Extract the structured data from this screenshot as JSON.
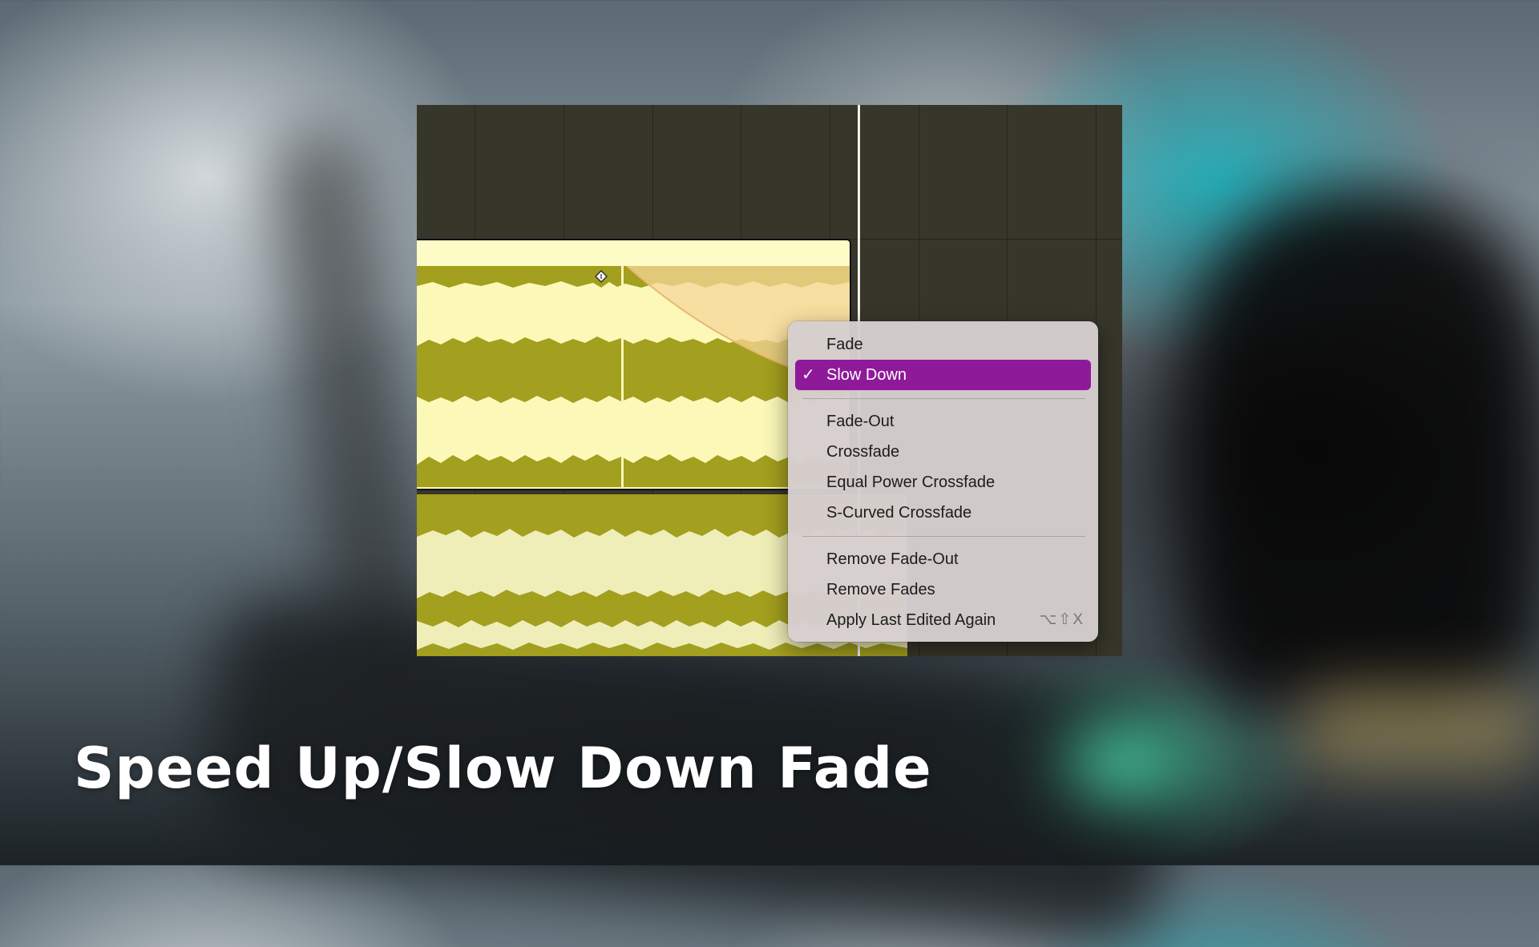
{
  "context_menu": {
    "items": [
      {
        "label": "Fade",
        "checked": false
      },
      {
        "label": "Slow Down",
        "checked": true,
        "check_glyph": "✓"
      },
      {
        "label": "Fade-Out"
      },
      {
        "label": "Crossfade"
      },
      {
        "label": "Equal Power Crossfade"
      },
      {
        "label": "S-Curved Crossfade"
      },
      {
        "label": "Remove Fade-Out"
      },
      {
        "label": "Remove Fades"
      },
      {
        "label": "Apply Last Edited Again",
        "shortcut": "⌥⇧X"
      }
    ],
    "selected_color": "#8e1a9a"
  },
  "caption": {
    "title": "Speed Up/Slow Down Fade"
  },
  "colors": {
    "region": "#fbf8b8",
    "waveform": "#a39f1f",
    "fade_overlay": "#f6d79a",
    "daw_background": "#36362a"
  },
  "icons": {
    "fade_handle": "diamond-handle-icon",
    "checkmark": "checkmark-icon"
  }
}
